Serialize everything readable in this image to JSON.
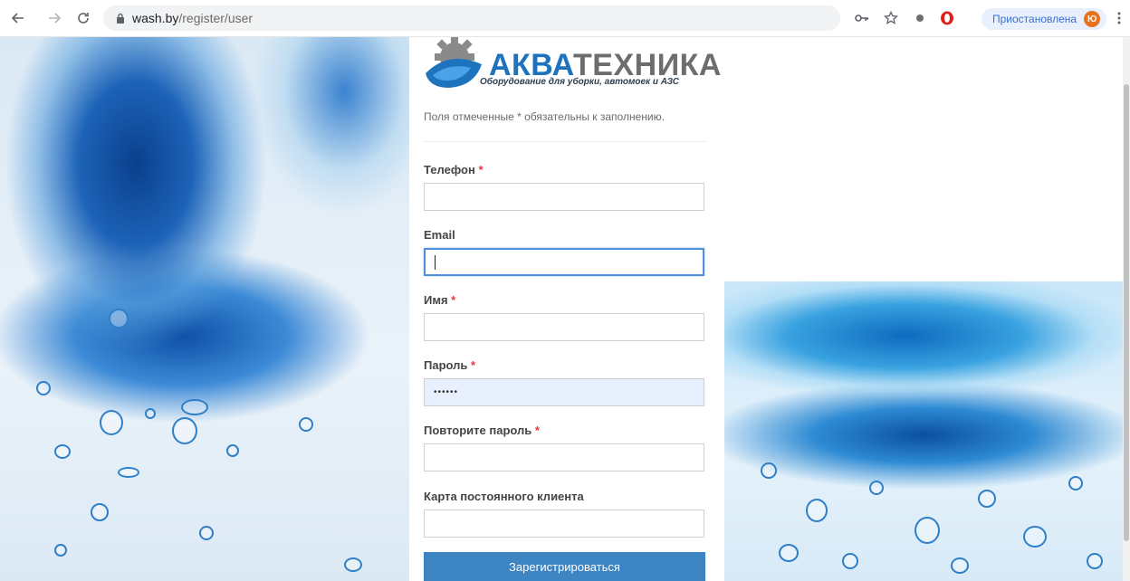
{
  "browser": {
    "url_host": "wash.by",
    "url_path": "/register/user",
    "profile_status": "Приостановлена",
    "profile_initial": "Ю",
    "icons": [
      "back-arrow-icon",
      "forward-arrow-icon",
      "reload-icon",
      "lock-icon",
      "key-icon",
      "star-icon",
      "extension-icon",
      "opera-icon",
      "menu-dots-icon"
    ]
  },
  "logo": {
    "brand_part1": "АКВА",
    "brand_part2": "ТЕХНИКА",
    "tagline": "Оборудование для уборки, автомоек и АЗС"
  },
  "form": {
    "required_note": "Поля отмеченные * обязательны к заполнению.",
    "fields": [
      {
        "label": "Телефон",
        "required": "*",
        "value": ""
      },
      {
        "label": "Email",
        "required": "",
        "value": ""
      },
      {
        "label": "Имя",
        "required": "*",
        "value": ""
      },
      {
        "label": "Пароль",
        "required": "*",
        "value": "••••••"
      },
      {
        "label": "Повторите пароль",
        "required": "*",
        "value": ""
      },
      {
        "label": "Карта постоянного клиента",
        "required": "",
        "value": ""
      }
    ],
    "submit_label": "Зарегистрироваться"
  },
  "colors": {
    "accent": "#3d84c2",
    "required": "#e53935",
    "focus": "#4e90d9",
    "autofill": "#e8f0fe"
  }
}
